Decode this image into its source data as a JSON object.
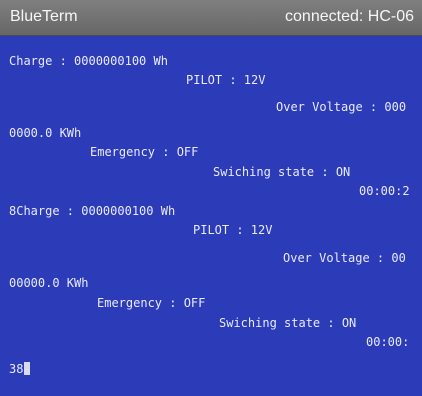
{
  "titlebar": {
    "app_name": "BlueTerm",
    "connection_status": "connected: HC-06"
  },
  "terminal": {
    "lines": [
      "Charge : 0000000100 Wh",
      "PILOT : 12V",
      "Over Voltage : 000",
      "0000.0 KWh",
      "Emergency : OFF",
      "Swiching state : ON",
      "00:00:2",
      "8Charge : 0000000100 Wh",
      "PILOT : 12V",
      "Over Voltage : 00",
      "00000.0 KWh",
      "Emergency : OFF",
      "Swiching state : ON",
      "00:00:",
      "38"
    ]
  },
  "colors": {
    "terminal_background": "#2c3bb8",
    "terminal_text": "#e9ebff",
    "titlebar_background": "#737373",
    "titlebar_text": "#f6f6f6"
  }
}
